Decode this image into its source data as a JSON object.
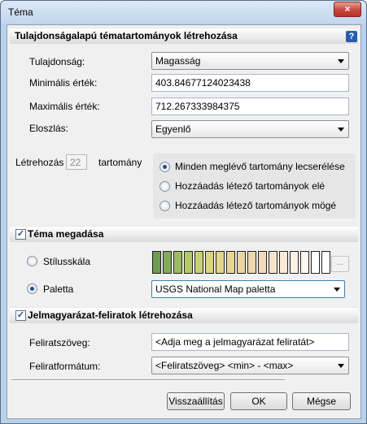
{
  "window": {
    "title": "Téma",
    "close_glyph": "×"
  },
  "section1": {
    "title": "Tulajdonságalapú tématartományok létrehozása",
    "help_glyph": "?",
    "property_label": "Tulajdonság:",
    "property_value": "Magasság",
    "min_label": "Minimális érték:",
    "min_value": "403.84677124023438",
    "max_label": "Maximális érték:",
    "max_value": "712.267333984375",
    "distribution_label": "Eloszlás:",
    "distribution_value": "Egyenlő",
    "create_label": "Létrehozás",
    "create_count": "22",
    "range_label": "tartomány",
    "options": [
      {
        "label": "Minden meglévő tartomány lecserélése",
        "selected": true
      },
      {
        "label": "Hozzáadás létező tartományok elé",
        "selected": false
      },
      {
        "label": "Hozzáadás létező tartományok mögé",
        "selected": false
      }
    ]
  },
  "section2": {
    "title": "Téma megadása",
    "checked": true,
    "style_scale_label": "Stílusskála",
    "style_scale_selected": false,
    "browse_glyph": "...",
    "swatch_colors": [
      "#6f9a52",
      "#86aa5b",
      "#9fbb62",
      "#b5c86a",
      "#c9d072",
      "#d9d67c",
      "#e2d789",
      "#e7d595",
      "#ebd5a2",
      "#efd6ae",
      "#f2dbbc",
      "#f5e2ca",
      "#f8e9d8",
      "#fbf1e6",
      "#fdf7f1",
      "#ffffff",
      "#ffffff"
    ],
    "palette_label": "Paletta",
    "palette_selected": true,
    "palette_value": "USGS National Map paletta"
  },
  "section3": {
    "title": "Jelmagyarázat-feliratok létrehozása",
    "checked": true,
    "caption_label": "Feliratszöveg:",
    "caption_value": "<Adja meg a jelmagyarázat feliratát>",
    "format_label": "Feliratformátum:",
    "format_value": "<Feliratszöveg> <min> - <max>"
  },
  "buttons": {
    "reset": "Visszaállítás",
    "ok": "OK",
    "cancel": "Mégse"
  },
  "icons": {
    "check": "✓"
  }
}
